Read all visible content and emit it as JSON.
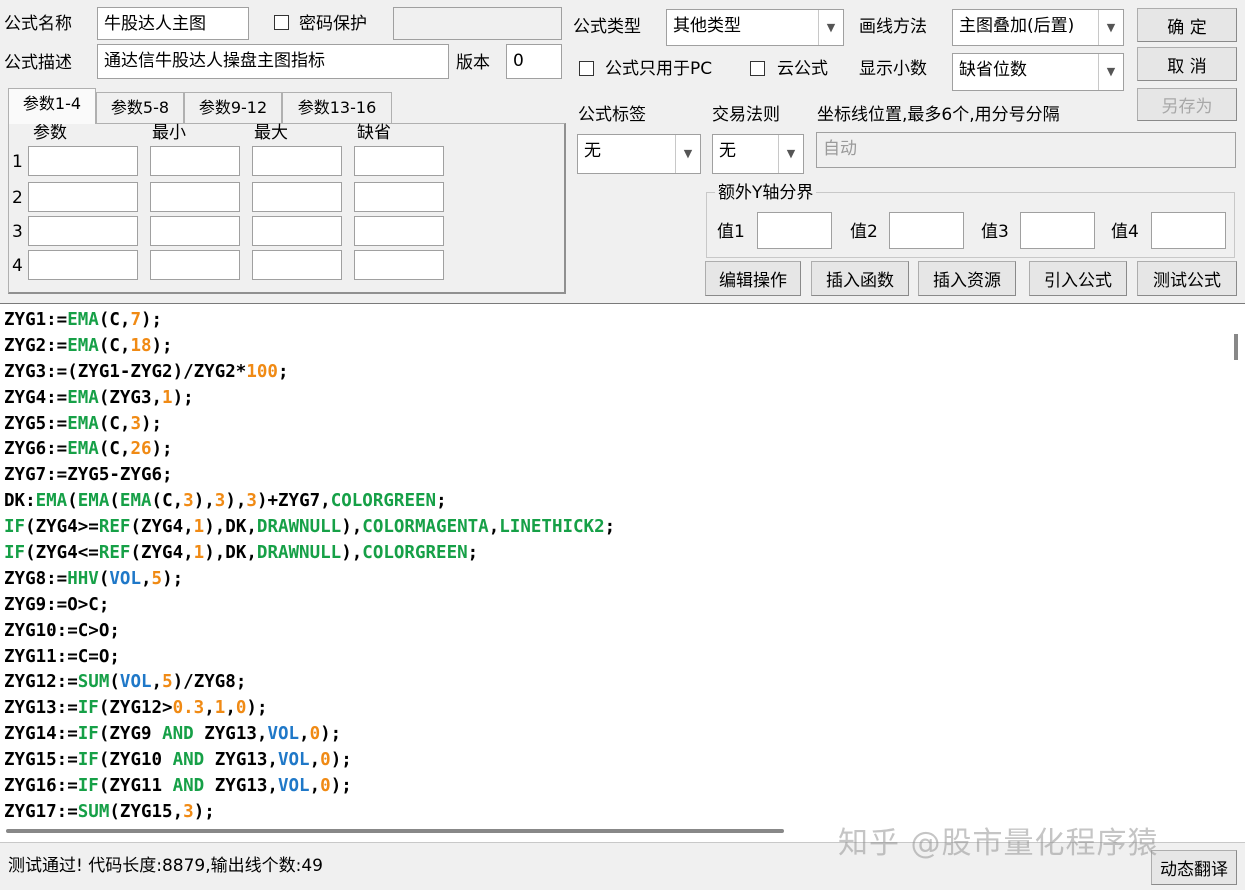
{
  "header": {
    "name_label": "公式名称",
    "name_value": "牛股达人主图",
    "password_label": "密码保护",
    "password_checked": false,
    "type_label": "公式类型",
    "type_value": "其他类型",
    "draw_label": "画线方法",
    "draw_value": "主图叠加(后置)",
    "desc_label": "公式描述",
    "desc_value": "通达信牛股达人操盘主图指标",
    "version_label": "版本",
    "version_value": "0",
    "pc_only_label": "公式只用于PC",
    "cloud_label": "云公式",
    "decimal_label": "显示小数",
    "decimal_value": "缺省位数"
  },
  "buttons": {
    "ok": "确  定",
    "cancel": "取  消",
    "save_as": "另存为",
    "edit": "编辑操作",
    "insert_func": "插入函数",
    "insert_res": "插入资源",
    "import": "引入公式",
    "test": "测试公式",
    "translate": "动态翻译"
  },
  "params": {
    "tabs": [
      "参数1-4",
      "参数5-8",
      "参数9-12",
      "参数13-16"
    ],
    "active_tab": 0,
    "columns": [
      "参数",
      "最小",
      "最大",
      "缺省"
    ],
    "rows": [
      "1",
      "2",
      "3",
      "4"
    ]
  },
  "right": {
    "tag_label": "公式标签",
    "tag_value": "无",
    "rule_label": "交易法则",
    "rule_value": "无",
    "coord_label": "坐标线位置,最多6个,用分号分隔",
    "coord_value": "自动",
    "yaxis_label": "额外Y轴分界",
    "values": [
      "值1",
      "值2",
      "值3",
      "值4"
    ]
  },
  "code": [
    [
      [
        "ZYG1:=",
        "text"
      ],
      [
        "EMA",
        "fn"
      ],
      [
        "(C,",
        "text"
      ],
      [
        "7",
        "num"
      ],
      [
        ");",
        "text"
      ]
    ],
    [
      [
        "ZYG2:=",
        "text"
      ],
      [
        "EMA",
        "fn"
      ],
      [
        "(C,",
        "text"
      ],
      [
        "18",
        "num"
      ],
      [
        ");",
        "text"
      ]
    ],
    [
      [
        "ZYG3:=(ZYG1-ZYG2)/ZYG2*",
        "text"
      ],
      [
        "100",
        "num"
      ],
      [
        ";",
        "text"
      ]
    ],
    [
      [
        "ZYG4:=",
        "text"
      ],
      [
        "EMA",
        "fn"
      ],
      [
        "(ZYG3,",
        "text"
      ],
      [
        "1",
        "num"
      ],
      [
        ");",
        "text"
      ]
    ],
    [
      [
        "ZYG5:=",
        "text"
      ],
      [
        "EMA",
        "fn"
      ],
      [
        "(C,",
        "text"
      ],
      [
        "3",
        "num"
      ],
      [
        ");",
        "text"
      ]
    ],
    [
      [
        "ZYG6:=",
        "text"
      ],
      [
        "EMA",
        "fn"
      ],
      [
        "(C,",
        "text"
      ],
      [
        "26",
        "num"
      ],
      [
        ");",
        "text"
      ]
    ],
    [
      [
        "ZYG7:=ZYG5-ZYG6;",
        "text"
      ]
    ],
    [
      [
        "DK:",
        "text"
      ],
      [
        "EMA",
        "fn"
      ],
      [
        "(",
        "text"
      ],
      [
        "EMA",
        "fn"
      ],
      [
        "(",
        "text"
      ],
      [
        "EMA",
        "fn"
      ],
      [
        "(C,",
        "text"
      ],
      [
        "3",
        "num"
      ],
      [
        "),",
        "text"
      ],
      [
        "3",
        "num"
      ],
      [
        "),",
        "text"
      ],
      [
        "3",
        "num"
      ],
      [
        ")+ZYG7,",
        "text"
      ],
      [
        "COLORGREEN",
        "kw"
      ],
      [
        ";",
        "text"
      ]
    ],
    [
      [
        "IF",
        "fn"
      ],
      [
        "(ZYG4>=",
        "text"
      ],
      [
        "REF",
        "fn"
      ],
      [
        "(ZYG4,",
        "text"
      ],
      [
        "1",
        "num"
      ],
      [
        "),DK,",
        "text"
      ],
      [
        "DRAWNULL",
        "kw"
      ],
      [
        "),",
        "text"
      ],
      [
        "COLORMAGENTA",
        "kw"
      ],
      [
        ",",
        "text"
      ],
      [
        "LINETHICK2",
        "kw"
      ],
      [
        ";",
        "text"
      ]
    ],
    [
      [
        "IF",
        "fn"
      ],
      [
        "(ZYG4<=",
        "text"
      ],
      [
        "REF",
        "fn"
      ],
      [
        "(ZYG4,",
        "text"
      ],
      [
        "1",
        "num"
      ],
      [
        "),DK,",
        "text"
      ],
      [
        "DRAWNULL",
        "kw"
      ],
      [
        "),",
        "text"
      ],
      [
        "COLORGREEN",
        "kw"
      ],
      [
        ";",
        "text"
      ]
    ],
    [
      [
        "ZYG8:=",
        "text"
      ],
      [
        "HHV",
        "fn"
      ],
      [
        "(",
        "text"
      ],
      [
        "VOL",
        "var"
      ],
      [
        ",",
        "text"
      ],
      [
        "5",
        "num"
      ],
      [
        ");",
        "text"
      ]
    ],
    [
      [
        "ZYG9:=O>C;",
        "text"
      ]
    ],
    [
      [
        "ZYG10:=C>O;",
        "text"
      ]
    ],
    [
      [
        "ZYG11:=C=O;",
        "text"
      ]
    ],
    [
      [
        "ZYG12:=",
        "text"
      ],
      [
        "SUM",
        "fn"
      ],
      [
        "(",
        "text"
      ],
      [
        "VOL",
        "var"
      ],
      [
        ",",
        "text"
      ],
      [
        "5",
        "num"
      ],
      [
        ")/ZYG8;",
        "text"
      ]
    ],
    [
      [
        "ZYG13:=",
        "text"
      ],
      [
        "IF",
        "fn"
      ],
      [
        "(ZYG12>",
        "text"
      ],
      [
        "0.3",
        "num"
      ],
      [
        ",",
        "text"
      ],
      [
        "1",
        "num"
      ],
      [
        ",",
        "text"
      ],
      [
        "0",
        "num"
      ],
      [
        ");",
        "text"
      ]
    ],
    [
      [
        "ZYG14:=",
        "text"
      ],
      [
        "IF",
        "fn"
      ],
      [
        "(ZYG9 ",
        "text"
      ],
      [
        "AND",
        "kw"
      ],
      [
        " ZYG13,",
        "text"
      ],
      [
        "VOL",
        "var"
      ],
      [
        ",",
        "text"
      ],
      [
        "0",
        "num"
      ],
      [
        ");",
        "text"
      ]
    ],
    [
      [
        "ZYG15:=",
        "text"
      ],
      [
        "IF",
        "fn"
      ],
      [
        "(ZYG10 ",
        "text"
      ],
      [
        "AND",
        "kw"
      ],
      [
        " ZYG13,",
        "text"
      ],
      [
        "VOL",
        "var"
      ],
      [
        ",",
        "text"
      ],
      [
        "0",
        "num"
      ],
      [
        ");",
        "text"
      ]
    ],
    [
      [
        "ZYG16:=",
        "text"
      ],
      [
        "IF",
        "fn"
      ],
      [
        "(ZYG11 ",
        "text"
      ],
      [
        "AND",
        "kw"
      ],
      [
        " ZYG13,",
        "text"
      ],
      [
        "VOL",
        "var"
      ],
      [
        ",",
        "text"
      ],
      [
        "0",
        "num"
      ],
      [
        ");",
        "text"
      ]
    ],
    [
      [
        "ZYG17:=",
        "text"
      ],
      [
        "SUM",
        "fn"
      ],
      [
        "(ZYG15,",
        "text"
      ],
      [
        "3",
        "num"
      ],
      [
        ");",
        "text"
      ]
    ]
  ],
  "status": "测试通过! 代码长度:8879,输出线个数:49",
  "watermark": "知乎 @股市量化程序猿"
}
